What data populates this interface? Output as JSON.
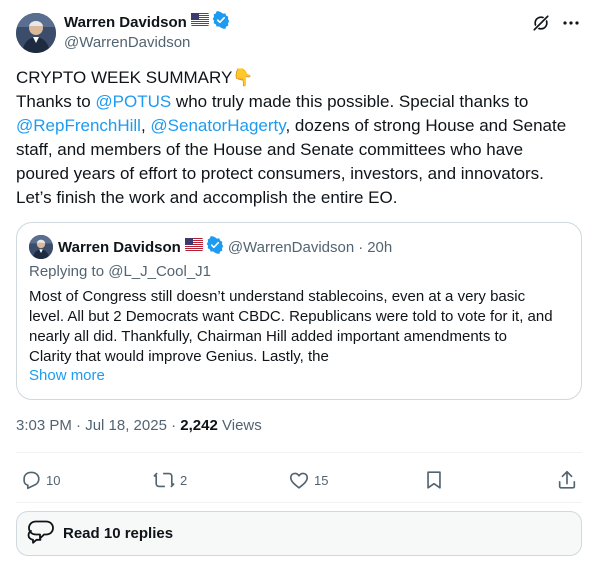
{
  "post": {
    "author": {
      "display_name": "Warren Davidson",
      "flag_emoji": "🇺🇸",
      "handle": "@WarrenDavidson",
      "verified": true
    },
    "body_lines": [
      [
        {
          "t": "CRYPTO WEEK SUMMARY👇",
          "m": false
        }
      ],
      [
        {
          "t": "Thanks to ",
          "m": false
        },
        {
          "t": "@POTUS",
          "m": true
        },
        {
          "t": " who truly made this possible. Special thanks to",
          "m": false
        }
      ],
      [
        {
          "t": "@RepFrenchHill",
          "m": true
        },
        {
          "t": ", ",
          "m": false
        },
        {
          "t": "@SenatorHagerty",
          "m": true
        },
        {
          "t": ", dozens of strong House and Senate",
          "m": false
        }
      ],
      [
        {
          "t": "staff, and members of the House and Senate committees who have",
          "m": false
        }
      ],
      [
        {
          "t": "poured years of effort to protect consumers, investors, and innovators.",
          "m": false
        }
      ],
      [
        {
          "t": "Let’s finish the work and accomplish the entire EO.",
          "m": false
        }
      ]
    ],
    "timestamp": "3:03 PM · Jul 18, 2025",
    "views_count": "2,242",
    "views_label": "Views"
  },
  "quote": {
    "display_name": "Warren Davidson",
    "flag_emoji": "🇺🇸",
    "handle": "@WarrenDavidson",
    "separator": "·",
    "time": "20h",
    "replying_to": "Replying to @L_J_Cool_J1",
    "text_lines": [
      "Most of Congress still doesn’t understand stablecoins, even at a very basic",
      "level. All but 2 Democrats want CBDC. Republicans were told to vote for it, and",
      "nearly all did. Thankfully, Chairman Hill added important amendments to",
      "Clarity that would improve Genius. Lastly, the"
    ],
    "show_more": "Show more"
  },
  "actions": {
    "replies": "10",
    "reposts": "2",
    "likes": "15"
  },
  "read_replies": "Read 10 replies",
  "colors": {
    "accent": "#1d9bf0",
    "secondary_text": "#536471",
    "primary_text": "#0f1419",
    "border": "#cfd9de"
  }
}
